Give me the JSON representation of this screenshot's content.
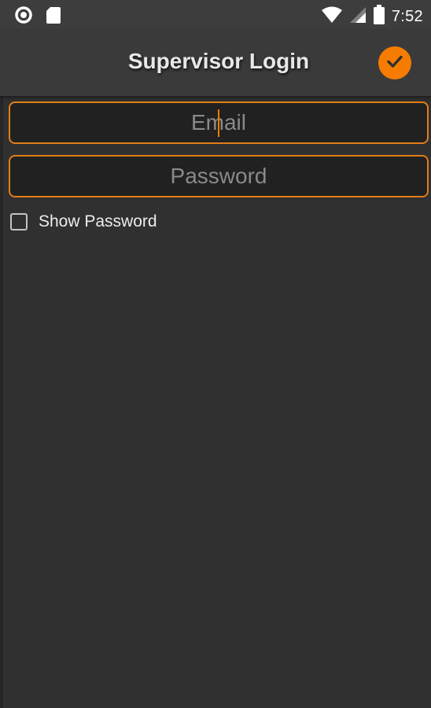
{
  "status_bar": {
    "time": "7:52",
    "icons": [
      "notification-ring-icon",
      "sd-card-icon",
      "wifi-icon",
      "cell-signal-icon",
      "battery-icon"
    ]
  },
  "app_bar": {
    "title": "Supervisor Login",
    "confirm_icon": "check-icon",
    "accent_color": "#f57c00"
  },
  "form": {
    "email": {
      "value": "",
      "placeholder": "Email"
    },
    "password": {
      "value": "",
      "placeholder": "Password"
    },
    "show_password": {
      "label": "Show Password",
      "checked": false
    }
  }
}
